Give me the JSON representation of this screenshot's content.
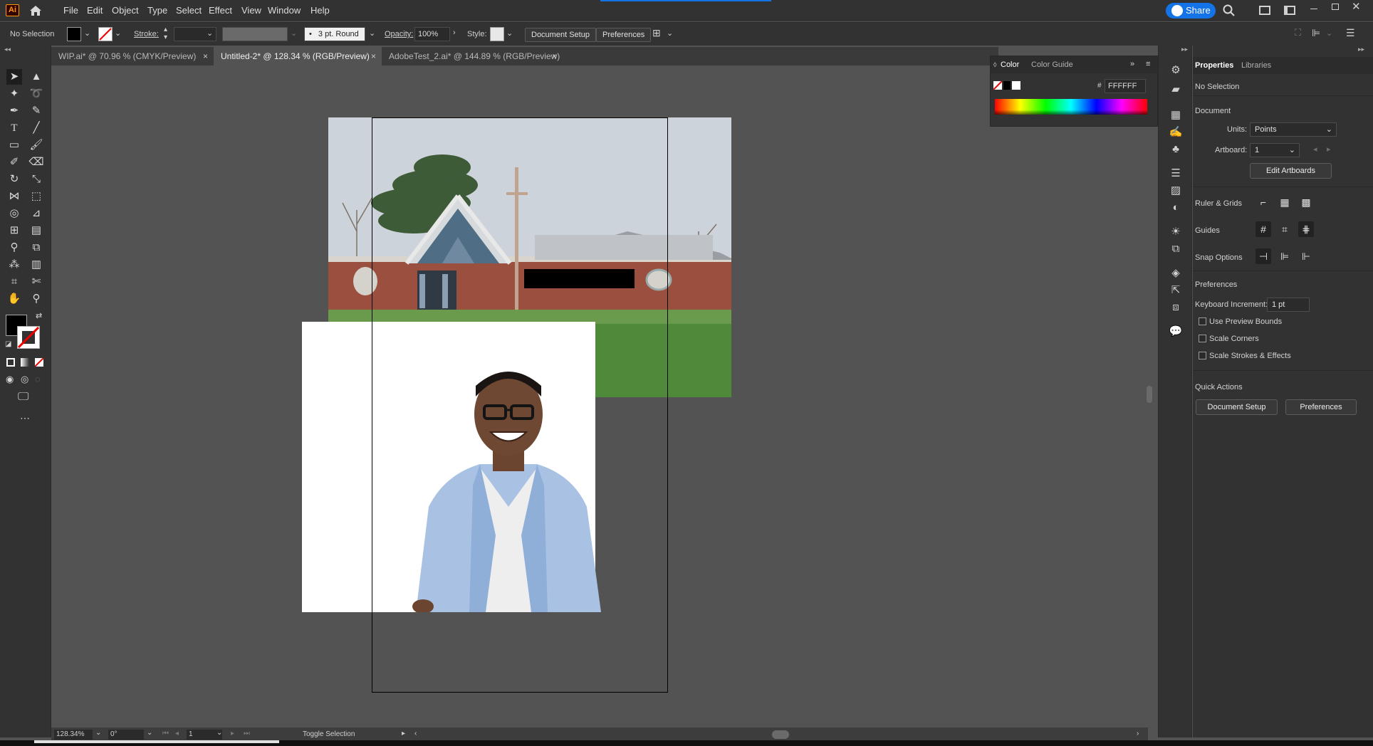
{
  "menubar": {
    "logo": "Ai",
    "items": [
      "File",
      "Edit",
      "Object",
      "Type",
      "Select",
      "Effect",
      "View",
      "Window",
      "Help"
    ],
    "share_label": "Share"
  },
  "control_bar": {
    "selection_status": "No Selection",
    "stroke_label": "Stroke:",
    "brush_label": "3 pt. Round",
    "opacity_label": "Opacity:",
    "opacity_value": "100%",
    "style_label": "Style:",
    "document_setup": "Document Setup",
    "preferences": "Preferences"
  },
  "tabs": [
    {
      "label": "WIP.ai* @ 70.96 % (CMYK/Preview)",
      "close": "×"
    },
    {
      "label": "Untitled-2* @ 128.34 % (RGB/Preview)",
      "close": "×"
    },
    {
      "label": "AdobeTest_2.ai* @ 144.89 % (RGB/Preview)",
      "close": "×"
    }
  ],
  "color_panel": {
    "tab_color": "Color",
    "tab_color_guide": "Color Guide",
    "hex_prefix": "#",
    "hex_value": "FFFFFF"
  },
  "properties": {
    "tab_properties": "Properties",
    "tab_libraries": "Libraries",
    "selection": "No Selection",
    "document_heading": "Document",
    "units_label": "Units:",
    "units_value": "Points",
    "artboard_label": "Artboard:",
    "artboard_value": "1",
    "edit_artboards": "Edit Artboards",
    "ruler_grids": "Ruler & Grids",
    "guides": "Guides",
    "snap_options": "Snap Options",
    "preferences_heading": "Preferences",
    "keyboard_increment_label": "Keyboard Increment:",
    "keyboard_increment_value": "1 pt",
    "use_preview_bounds": "Use Preview Bounds",
    "scale_corners": "Scale Corners",
    "scale_strokes": "Scale Strokes & Effects",
    "quick_actions": "Quick Actions",
    "qa_document_setup": "Document Setup",
    "qa_preferences": "Preferences"
  },
  "status_bar": {
    "zoom": "128.34%",
    "rotation": "0°",
    "artboard_number": "1",
    "toggle_label": "Toggle Selection"
  },
  "colors": {
    "accent": "#1473e6",
    "app_bg": "#323232",
    "canvas_bg": "#535353",
    "logo": "#ff9a00"
  }
}
